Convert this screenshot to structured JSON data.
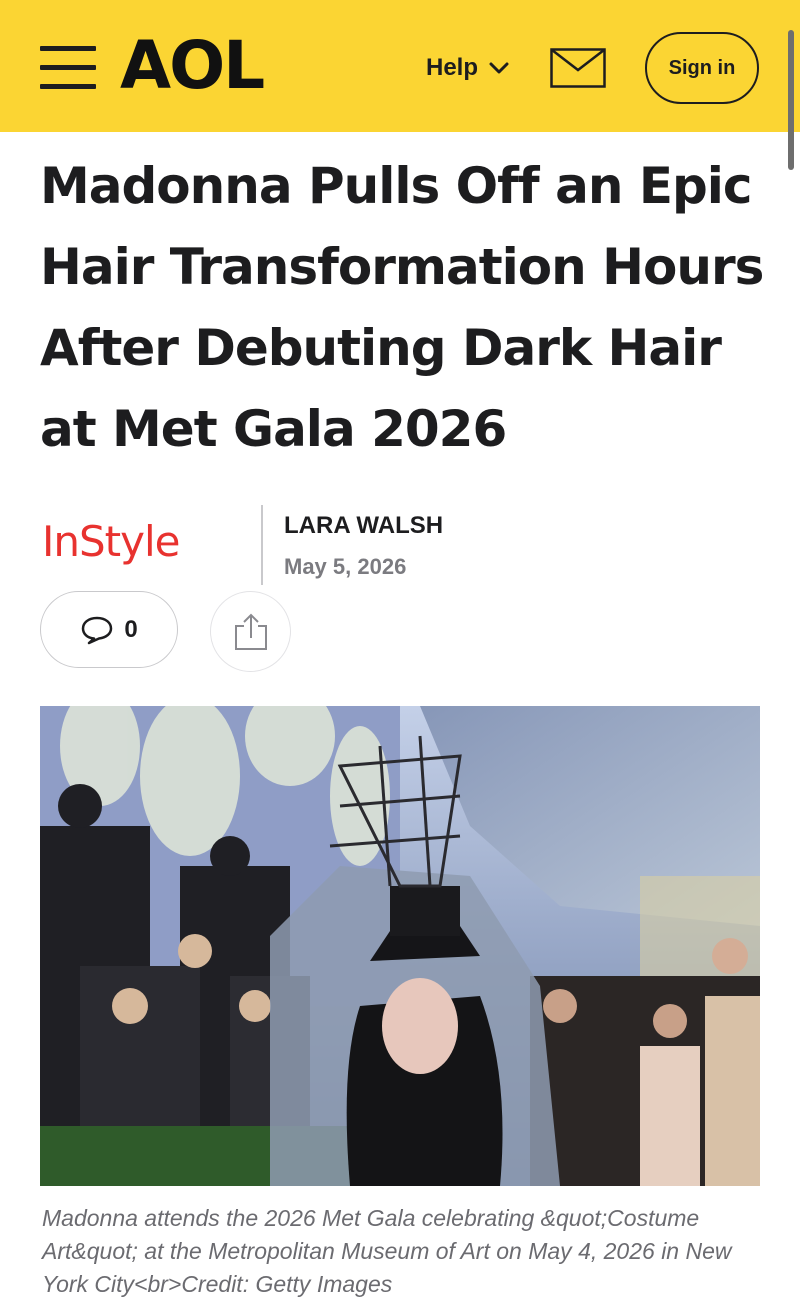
{
  "header": {
    "logo": "AOL",
    "help_label": "Help",
    "signin_label": "Sign in",
    "background_color": "#fbd533"
  },
  "article": {
    "title": "Madonna Pulls Off an Epic Hair Transformation Hours After Debuting Dark Hair at Met Gala 2026",
    "source": "InStyle",
    "source_color": "#e8322f",
    "author": "LARA WALSH",
    "date": "May 5, 2026",
    "comment_count": "0",
    "caption": "Madonna attends the 2026 Met Gala celebrating &quot;Costume Art&quot; at the Metropolitan Museum of Art on May 4, 2026 in New York City<br>Credit: Getty Images"
  },
  "icons": {
    "menu": "hamburger-menu-icon",
    "help_toggle": "chevron-down-icon",
    "mail": "mail-envelope-icon",
    "comment": "speech-bubble-icon",
    "share": "share-upload-icon"
  }
}
